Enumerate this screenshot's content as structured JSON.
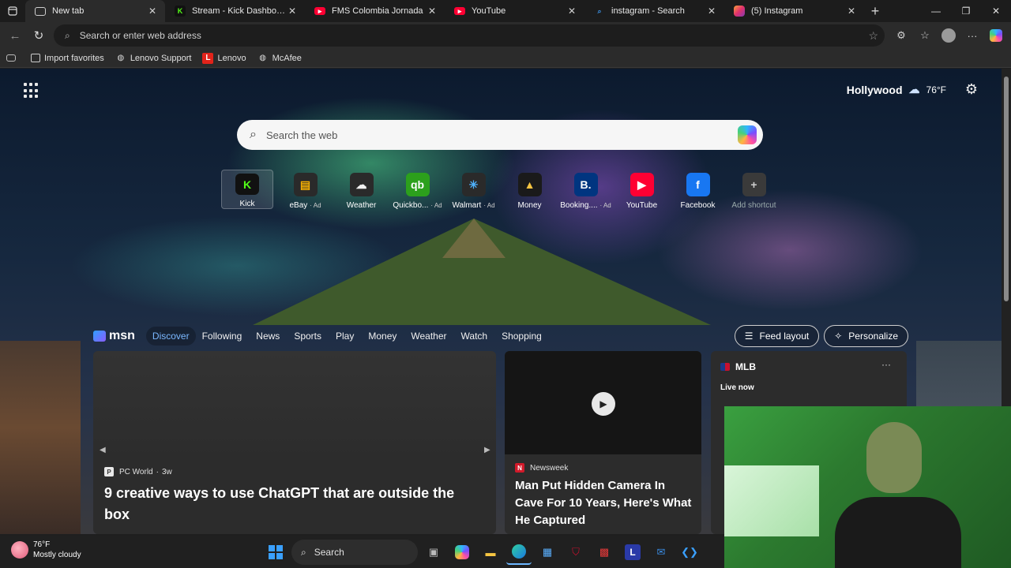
{
  "tabs": [
    {
      "title": "New tab",
      "icon": "newtab-icon",
      "color": "#cfcfcf",
      "active": true
    },
    {
      "title": "Stream - Kick Dashboard",
      "icon": "kick-icon",
      "color": "#53fc18"
    },
    {
      "title": "FMS Colombia Jornada",
      "icon": "youtube-icon",
      "color": "#ff0033"
    },
    {
      "title": "YouTube",
      "icon": "youtube-icon",
      "color": "#ff0033"
    },
    {
      "title": "instagram - Search",
      "icon": "search-icon",
      "color": "#3a8dde"
    },
    {
      "title": "(5) Instagram",
      "icon": "instagram-icon",
      "color": "#e1306c"
    }
  ],
  "address_bar": {
    "placeholder": "Search or enter web address"
  },
  "favorites": [
    {
      "label": "Import favorites",
      "icon": "import-icon"
    },
    {
      "label": "Lenovo Support",
      "icon": "globe-icon"
    },
    {
      "label": "Lenovo",
      "icon": "lenovo-icon"
    },
    {
      "label": "McAfee",
      "icon": "globe-icon"
    }
  ],
  "weather": {
    "location": "Hollywood",
    "temp": "76°F",
    "icon": "cloud-icon"
  },
  "search": {
    "placeholder": "Search the web"
  },
  "shortcuts": [
    {
      "label": "Kick",
      "ad": "",
      "icon_text": "K",
      "bg": "#111111",
      "fg": "#53fc18"
    },
    {
      "label": "eBay",
      "ad": "· Ad",
      "icon_text": "▤",
      "bg": "#2a2a2a",
      "fg": "#f5af02"
    },
    {
      "label": "Weather",
      "ad": "",
      "icon_text": "☁",
      "bg": "#2a2a2a",
      "fg": "#f0f0f0"
    },
    {
      "label": "Quickbo...",
      "ad": "· Ad",
      "icon_text": "qb",
      "bg": "#2ca01c",
      "fg": "#ffffff"
    },
    {
      "label": "Walmart",
      "ad": "· Ad",
      "icon_text": "✳",
      "bg": "#2a2a2a",
      "fg": "#4fb3ff"
    },
    {
      "label": "Money",
      "ad": "",
      "icon_text": "▲",
      "bg": "#1a1a1a",
      "fg": "#f5c542"
    },
    {
      "label": "Booking....",
      "ad": "· Ad",
      "icon_text": "B.",
      "bg": "#003580",
      "fg": "#ffffff"
    },
    {
      "label": "YouTube",
      "ad": "",
      "icon_text": "▶",
      "bg": "#ff0033",
      "fg": "#ffffff"
    },
    {
      "label": "Facebook",
      "ad": "",
      "icon_text": "f",
      "bg": "#1877f2",
      "fg": "#ffffff"
    },
    {
      "label": "Add shortcut",
      "ad": "",
      "icon_text": "+",
      "bg": "#3a3a3a",
      "fg": "#cfcfcf"
    }
  ],
  "msn": {
    "logo": "msn",
    "nav": [
      "Discover",
      "Following",
      "News",
      "Sports",
      "Play",
      "Money",
      "Weather",
      "Watch",
      "Shopping"
    ],
    "active_nav": "Discover",
    "feed_layout": "Feed layout",
    "personalize": "Personalize"
  },
  "cards": [
    {
      "source": "PC World",
      "age": "3w",
      "title": "9 creative ways to use ChatGPT that are outside the box"
    },
    {
      "source": "Newsweek",
      "title": "Man Put Hidden Camera In Cave For 10 Years, Here's What He Captured"
    },
    {
      "source": "MLB",
      "status": "Live now"
    }
  ],
  "taskbar": {
    "temp": "76°F",
    "condition": "Mostly cloudy",
    "search_label": "Search"
  }
}
